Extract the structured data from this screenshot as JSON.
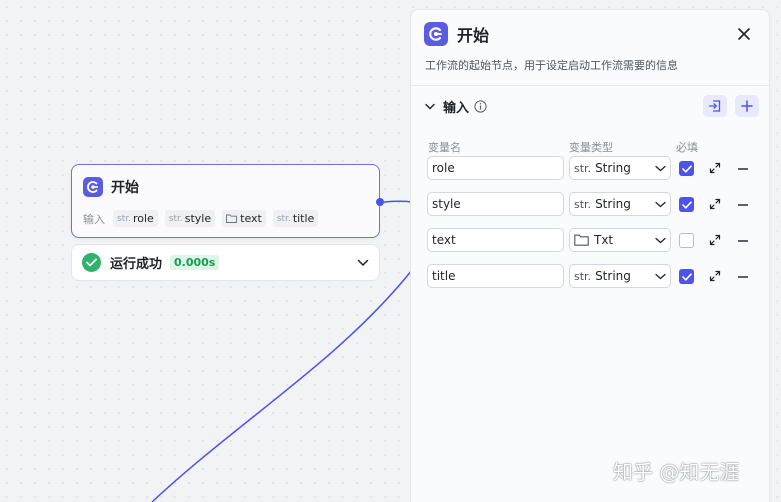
{
  "node": {
    "title": "开始",
    "inputs_label": "输入",
    "inputs": [
      {
        "type": "str.",
        "name": "role"
      },
      {
        "type": "str.",
        "name": "style"
      },
      {
        "type": "folder",
        "name": "text"
      },
      {
        "type": "str.",
        "name": "title"
      }
    ]
  },
  "run": {
    "status": "运行成功",
    "time": "0.000s"
  },
  "panel": {
    "title": "开始",
    "description": "工作流的起始节点，用于设定启动工作流需要的信息",
    "section_title": "输入",
    "columns": {
      "name": "变量名",
      "type": "变量类型",
      "required": "必填"
    },
    "rows": [
      {
        "name": "role",
        "type_prefix": "str.",
        "type": "String",
        "required": true
      },
      {
        "name": "style",
        "type_prefix": "str.",
        "type": "String",
        "required": true
      },
      {
        "name": "text",
        "type_prefix": "",
        "type": "Txt",
        "required": false
      },
      {
        "name": "title",
        "type_prefix": "str.",
        "type": "String",
        "required": true
      }
    ]
  },
  "watermark": "知乎 @知无涯",
  "colors": {
    "accent": "#4d53e8",
    "success": "#2fb26b"
  }
}
